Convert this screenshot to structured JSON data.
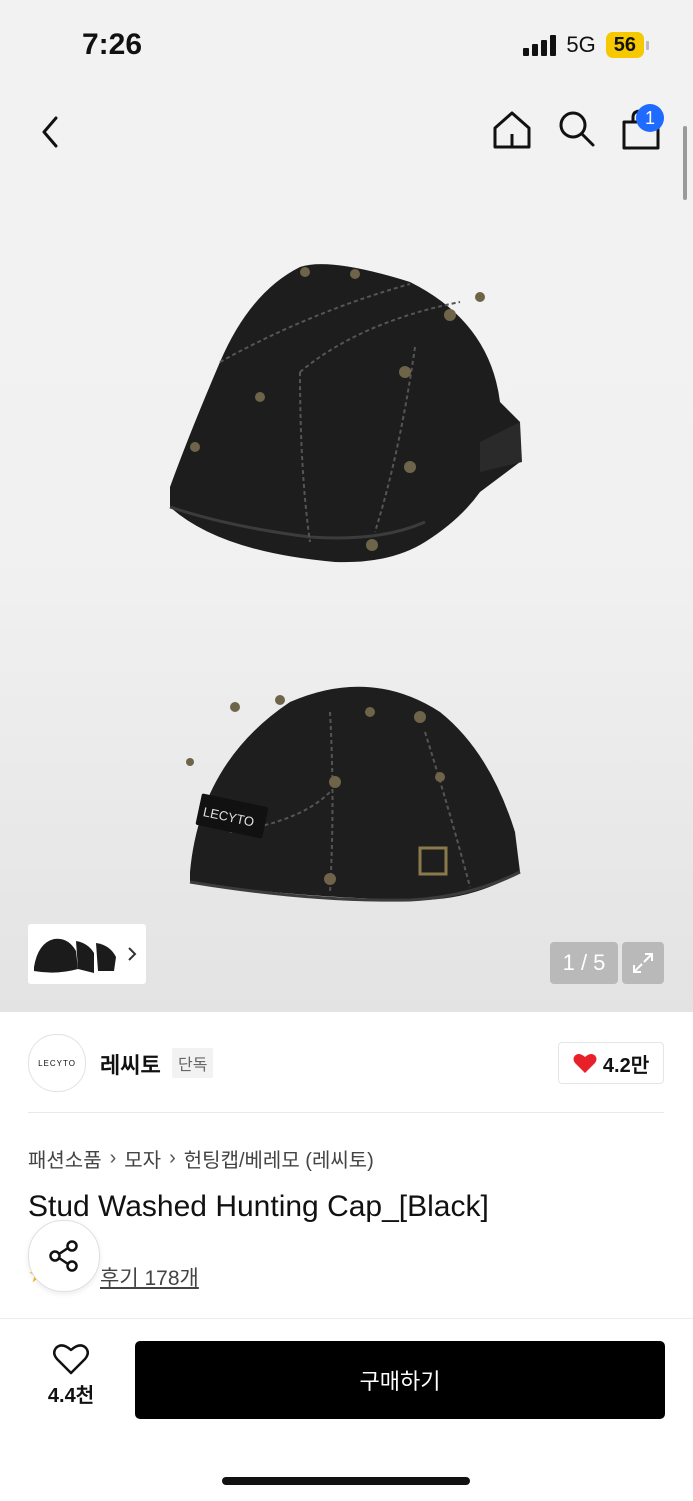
{
  "status_bar": {
    "time": "7:26",
    "network": "5G",
    "battery": "56"
  },
  "nav": {
    "cart_count": "1"
  },
  "gallery": {
    "counter": "1 / 5",
    "logo_text": "LECYTO"
  },
  "brand": {
    "name": "레씨토",
    "tag": "단독",
    "logo_text": "LECYTO",
    "likes": "4.2만"
  },
  "breadcrumb": [
    "패션소품",
    "모자",
    "헌팅캡/베레모 (레씨토)"
  ],
  "product": {
    "title": "Stud Washed Hunting Cap_[Black]",
    "review_text": "후기 178개"
  },
  "bottom": {
    "wish_count": "4.4천",
    "buy_label": "구매하기"
  },
  "colors": {
    "accent_blue": "#1f6bff",
    "heart_red": "#e8202a",
    "star_gold": "#f5b800"
  },
  "icons": [
    "back-icon",
    "home-icon",
    "search-icon",
    "shopping-bag-icon",
    "chevron-right-icon",
    "expand-icon",
    "heart-icon",
    "share-icon",
    "star-icon"
  ]
}
